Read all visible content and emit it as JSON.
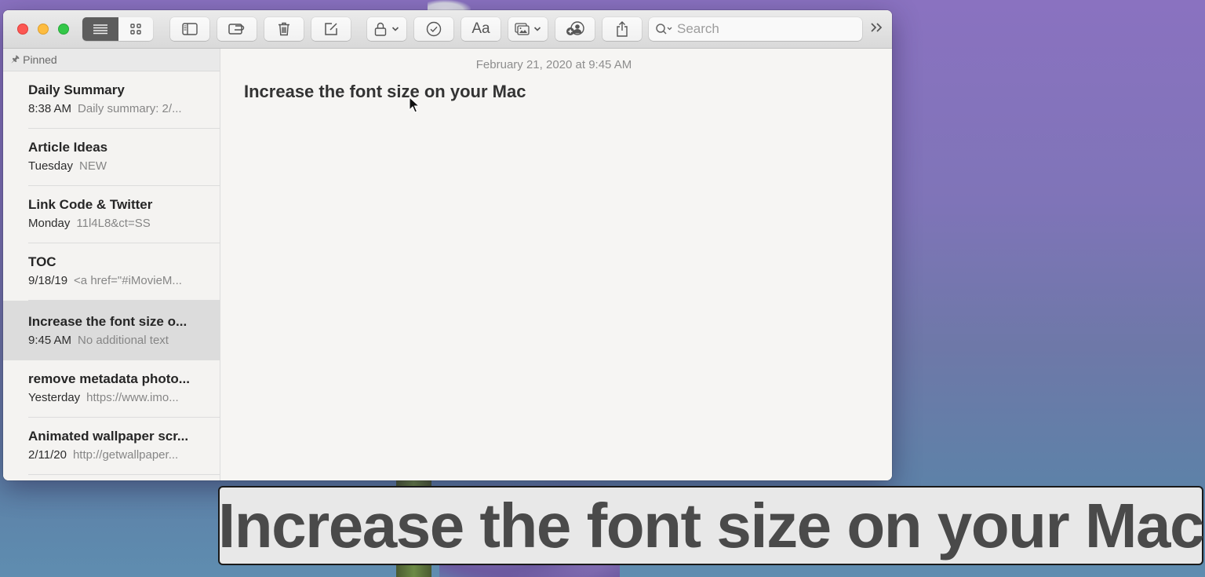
{
  "toolbar": {
    "view_list_icon": "list-view-icon",
    "view_gallery_icon": "gallery-view-icon",
    "buttons": [
      {
        "name": "toggle-sidebar",
        "icon": "sidebar-icon"
      },
      {
        "name": "attachments",
        "icon": "attachment-browser-icon"
      },
      {
        "name": "delete",
        "icon": "trash-icon"
      },
      {
        "name": "new-note",
        "icon": "compose-icon"
      },
      {
        "name": "lock",
        "icon": "lock-icon"
      },
      {
        "name": "checklist",
        "icon": "checklist-icon"
      },
      {
        "name": "format",
        "label": "Aa"
      },
      {
        "name": "media",
        "icon": "photo-icon"
      },
      {
        "name": "add-people",
        "icon": "add-people-icon"
      },
      {
        "name": "share",
        "icon": "share-icon"
      }
    ],
    "format_label": "Aa",
    "search_placeholder": "Search",
    "overflow_label": "»"
  },
  "sidebar": {
    "section_label": "Pinned",
    "notes": [
      {
        "title": "Daily Summary",
        "date": "8:38 AM",
        "preview": "Daily summary: 2/..."
      },
      {
        "title": "Article Ideas",
        "date": "Tuesday",
        "preview": "NEW"
      },
      {
        "title": "Link Code & Twitter",
        "date": "Monday",
        "preview": "11l4L8&ct=SS"
      },
      {
        "title": "TOC",
        "date": "9/18/19",
        "preview": "<a href=\"#iMovieM..."
      },
      {
        "title": "Increase the font size o...",
        "date": "9:45 AM",
        "preview": "No additional text",
        "selected": true
      },
      {
        "title": "remove metadata photo...",
        "date": "Yesterday",
        "preview": "https://www.imo..."
      },
      {
        "title": "Animated wallpaper scr...",
        "date": "2/11/20",
        "preview": "http://getwallpaper..."
      }
    ]
  },
  "editor": {
    "date": "February 21, 2020 at 9:45 AM",
    "title": "Increase the font size on your Mac"
  },
  "caption": {
    "text": "Increase the font size on your Mac"
  },
  "colors": {
    "close": "#fc5753",
    "minimize": "#fdbc40",
    "maximize": "#33c748",
    "selected_row": "#dcdcdc"
  }
}
